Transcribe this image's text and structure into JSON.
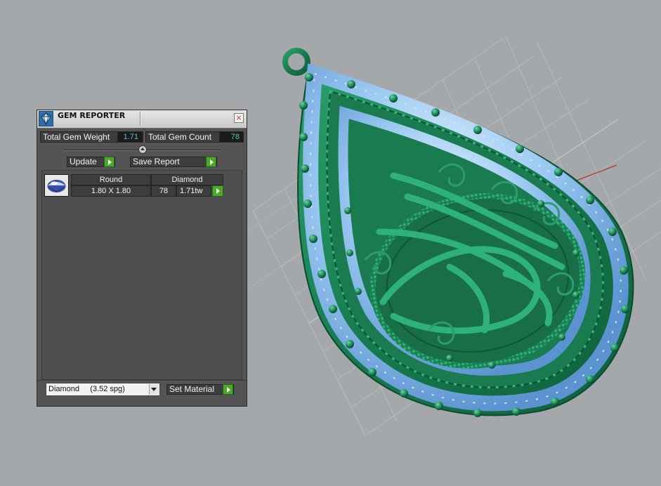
{
  "panel": {
    "title": "GEM REPORTER",
    "close_glyph": "×",
    "icon": "gem-reporter-icon"
  },
  "totals": {
    "weight_label": "Total Gem Weight",
    "weight_value": "1.71",
    "count_label": "Total Gem Count",
    "count_value": "78"
  },
  "actions": {
    "update_label": "Update",
    "save_report_label": "Save Report"
  },
  "gem_table": {
    "headers": [
      "Round",
      "Diamond"
    ],
    "rows": [
      {
        "thumbnail": "round-gem-icon",
        "size": "1.80 X 1.80",
        "count": "78",
        "weight": "1.71tw"
      }
    ]
  },
  "material": {
    "selected": "Diamond     (3.52 spg)",
    "set_label": "Set Material"
  },
  "colors": {
    "accent_green": "#4fa62e",
    "value_text": "#51c6d2",
    "model_metal": "#1f8a5c",
    "model_gems": "#8fc4f0",
    "viewport_bg": "#a4a8aa"
  }
}
